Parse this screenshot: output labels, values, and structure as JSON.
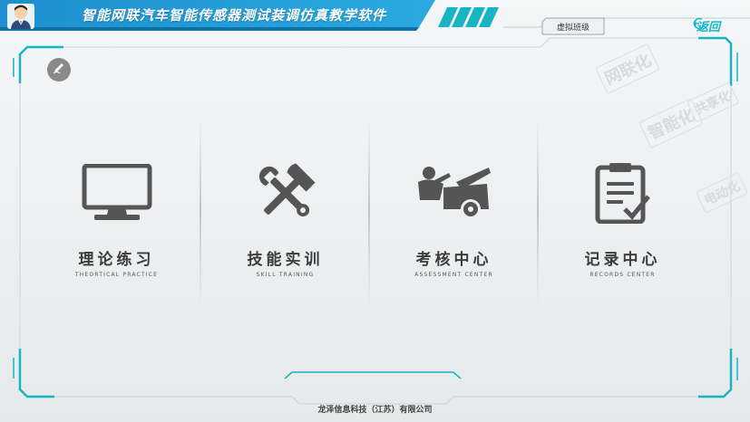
{
  "header": {
    "title": "智能网联汽车智能传感器测试装调仿真教学软件",
    "class_tab": "虚拟班级",
    "back_label": "返回"
  },
  "watermarks": [
    "网联化",
    "智能化",
    "共享化",
    "电动化"
  ],
  "modules": [
    {
      "title": "理论练习",
      "subtitle": "THEORTICAL PRACTICE",
      "icon": "monitor-icon"
    },
    {
      "title": "技能实训",
      "subtitle": "SKILL TRAINING",
      "icon": "tools-icon"
    },
    {
      "title": "考核中心",
      "subtitle": "ASSESSMENT CENTER",
      "icon": "car-repair-icon"
    },
    {
      "title": "记录中心",
      "subtitle": "RECORDS CENTER",
      "icon": "clipboard-icon"
    }
  ],
  "footer": {
    "company": "龙泽信息科技（江苏）有限公司"
  },
  "colors": {
    "header_blue": "#1a9ad6",
    "accent_teal": "#10b8c8",
    "icon_gray": "#555555"
  }
}
